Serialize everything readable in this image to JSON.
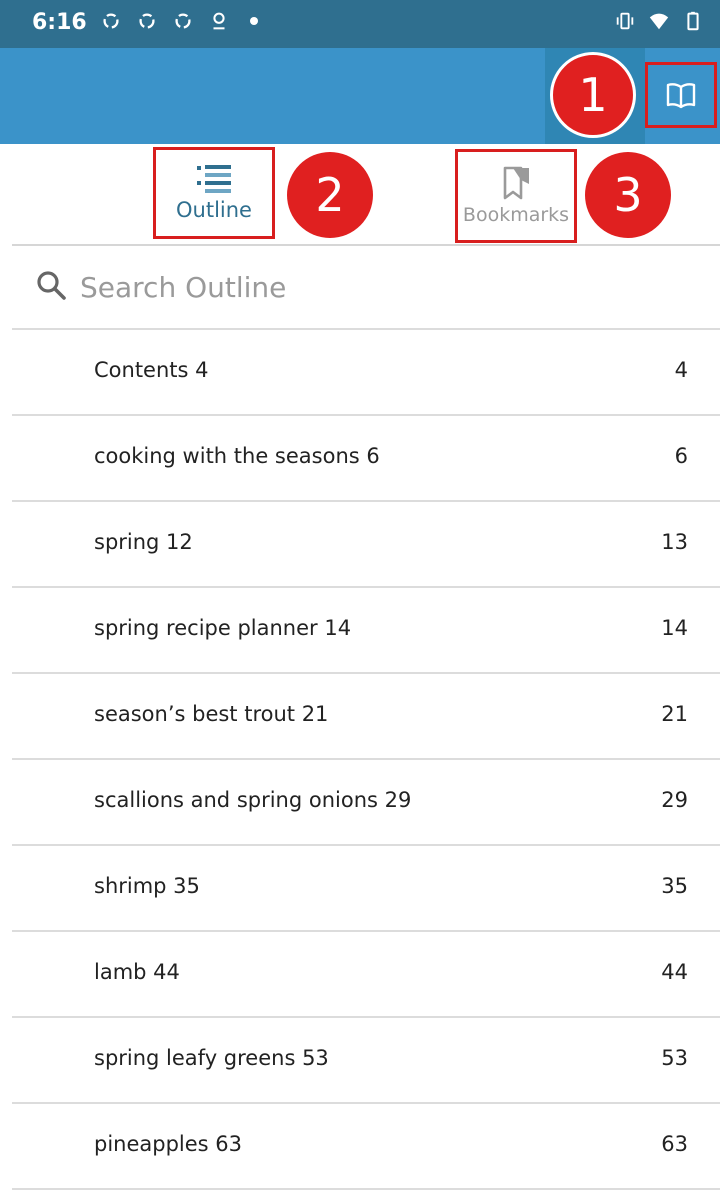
{
  "status_bar": {
    "time": "6:16"
  },
  "annotations": {
    "badge_1": "1",
    "badge_2": "2",
    "badge_3": "3"
  },
  "tabs": {
    "outline_label": "Outline",
    "bookmarks_label": "Bookmarks"
  },
  "search": {
    "placeholder": "Search Outline"
  },
  "outline": {
    "items": [
      {
        "title": "Contents 4",
        "page": "4"
      },
      {
        "title": "cooking with the seasons 6",
        "page": "6"
      },
      {
        "title": "spring 12",
        "page": "13"
      },
      {
        "title": "spring recipe planner 14",
        "page": "14"
      },
      {
        "title": "season’s best trout 21",
        "page": "21"
      },
      {
        "title": "scallions and spring onions 29",
        "page": "29"
      },
      {
        "title": "shrimp 35",
        "page": "35"
      },
      {
        "title": "lamb 44",
        "page": "44"
      },
      {
        "title": "spring leafy greens 53",
        "page": "53"
      },
      {
        "title": "pineapples 63",
        "page": "63"
      }
    ]
  },
  "colors": {
    "status_bar": "#2f6f8f",
    "app_bar": "#3b93c9",
    "active_tab": "#2f6f8f",
    "annotation_red": "#e02020"
  },
  "icons": {
    "app_bar": "book-open-icon",
    "outline_tab": "list-outline-icon",
    "bookmarks_tab": "bookmark-icon",
    "search": "search-icon"
  }
}
